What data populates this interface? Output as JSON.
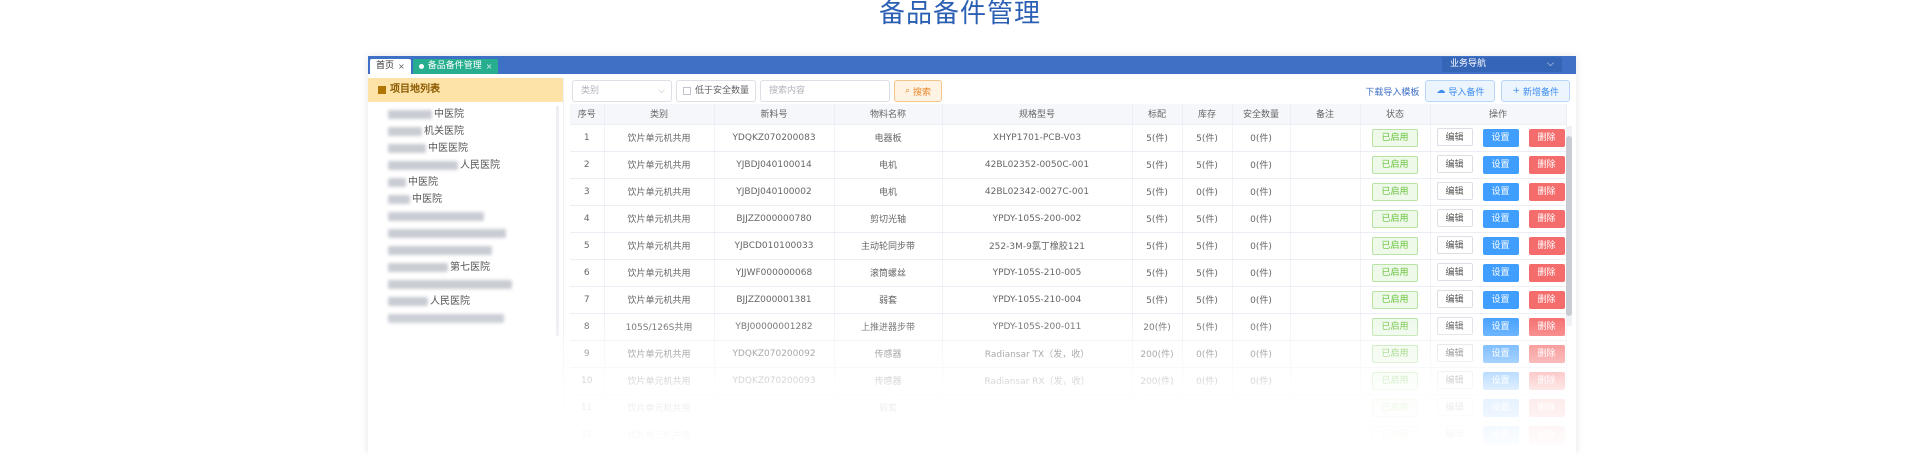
{
  "page": {
    "title": "备品备件管理"
  },
  "topbar": {
    "tabs": [
      {
        "label": "首页"
      },
      {
        "label": "备品备件管理"
      }
    ],
    "nav_select": "业务导航",
    "color": "#3e70c6"
  },
  "sidebar": {
    "header": "项目地列表",
    "items": [
      {
        "visible": "中医院"
      },
      {
        "visible": "机关医院"
      },
      {
        "visible": "中医医院"
      },
      {
        "visible": "人民医院"
      },
      {
        "visible": "中医院"
      },
      {
        "visible": "中医院"
      },
      {
        "visible": ""
      },
      {
        "visible": ""
      },
      {
        "visible": ""
      },
      {
        "visible": "第七医院"
      },
      {
        "visible": ""
      },
      {
        "visible": "人民医院"
      },
      {
        "visible": ""
      }
    ]
  },
  "toolbar": {
    "category_placeholder": "类别",
    "below_safety_label": "低于安全数量",
    "search_placeholder": "搜索内容",
    "search_label": "搜索",
    "download_template": "下载导入模板",
    "import_label": "导入备件",
    "add_label": "新增备件"
  },
  "table": {
    "columns": [
      "序号",
      "类别",
      "新料号",
      "物料名称",
      "规格型号",
      "标配",
      "库存",
      "安全数量",
      "备注",
      "状态",
      "操作"
    ],
    "actions": {
      "edit": "编辑",
      "set": "设置",
      "delete": "删除"
    },
    "rows": [
      {
        "index": "1",
        "category": "饮片单元机共用",
        "part_no": "YDQKZ070200083",
        "name": "电器板",
        "spec": "XHYP1701-PCB-V03",
        "standard": "5(件)",
        "stock": "5(件)",
        "stock_warn": false,
        "safety": "0(件)",
        "remark": "",
        "status": "已启用"
      },
      {
        "index": "2",
        "category": "饮片单元机共用",
        "part_no": "YJBDJ040100014",
        "name": "电机",
        "spec": "42BL02352-0050C-001",
        "standard": "5(件)",
        "stock": "5(件)",
        "stock_warn": false,
        "safety": "0(件)",
        "remark": "",
        "status": "已启用"
      },
      {
        "index": "3",
        "category": "饮片单元机共用",
        "part_no": "YJBDJ040100002",
        "name": "电机",
        "spec": "42BL02342-0027C-001",
        "standard": "5(件)",
        "stock": "0(件)",
        "stock_warn": true,
        "safety": "0(件)",
        "remark": "",
        "status": "已启用"
      },
      {
        "index": "4",
        "category": "饮片单元机共用",
        "part_no": "BJJZZ000000780",
        "name": "剪切光轴",
        "spec": "YPDY-105S-200-002",
        "standard": "5(件)",
        "stock": "5(件)",
        "stock_warn": false,
        "safety": "0(件)",
        "remark": "",
        "status": "已启用"
      },
      {
        "index": "5",
        "category": "饮片单元机共用",
        "part_no": "YJBCD010100033",
        "name": "主动轮同步带",
        "spec": "252-3M-9氯丁橡胶121",
        "standard": "5(件)",
        "stock": "5(件)",
        "stock_warn": false,
        "safety": "0(件)",
        "remark": "",
        "status": "已启用"
      },
      {
        "index": "6",
        "category": "饮片单元机共用",
        "part_no": "YJJWF000000068",
        "name": "滚筒螺丝",
        "spec": "YPDY-105S-210-005",
        "standard": "5(件)",
        "stock": "5(件)",
        "stock_warn": false,
        "safety": "0(件)",
        "remark": "",
        "status": "已启用"
      },
      {
        "index": "7",
        "category": "饮片单元机共用",
        "part_no": "BJJZZ000001381",
        "name": "弱套",
        "spec": "YPDY-105S-210-004",
        "standard": "5(件)",
        "stock": "5(件)",
        "stock_warn": false,
        "safety": "0(件)",
        "remark": "",
        "status": "已启用"
      },
      {
        "index": "8",
        "category": "105S/126S共用",
        "part_no": "YBJ00000001282",
        "name": "上推进器步带",
        "spec": "YPDY-105S-200-011",
        "standard": "20(件)",
        "stock": "5(件)",
        "stock_warn": false,
        "safety": "0(件)",
        "remark": "",
        "status": "已启用"
      },
      {
        "index": "9",
        "category": "饮片单元机共用",
        "part_no": "YDQKZ070200092",
        "name": "传感器",
        "spec": "Radiansar TX（发，收）",
        "standard": "200(件)",
        "stock": "0(件)",
        "stock_warn": true,
        "safety": "0(件)",
        "remark": "",
        "status": "已启用"
      },
      {
        "index": "10",
        "category": "饮片单元机共用",
        "part_no": "YDQKZ070200093",
        "name": "传感器",
        "spec": "Radiansar RX（发，收）",
        "standard": "200(件)",
        "stock": "0(件)",
        "stock_warn": true,
        "safety": "0(件)",
        "remark": "",
        "status": "已启用"
      },
      {
        "index": "11",
        "category": "饮片单元机共用",
        "part_no": "",
        "name": "弱套",
        "spec": "",
        "standard": "",
        "stock": "",
        "stock_warn": false,
        "safety": "",
        "remark": "",
        "status": "已启用"
      },
      {
        "index": "12",
        "category": "饮片单元机共用",
        "part_no": "",
        "name": "",
        "spec": "",
        "standard": "",
        "stock": "",
        "stock_warn": false,
        "safety": "",
        "remark": "",
        "status": "已启用"
      }
    ]
  },
  "colors": {
    "accent": "#3e70c6",
    "tab_active": "#27ae8f",
    "warn": "#f23a3a",
    "status_green": "#67c23a",
    "btn_blue": "#409eff",
    "btn_red": "#f56c6c"
  }
}
